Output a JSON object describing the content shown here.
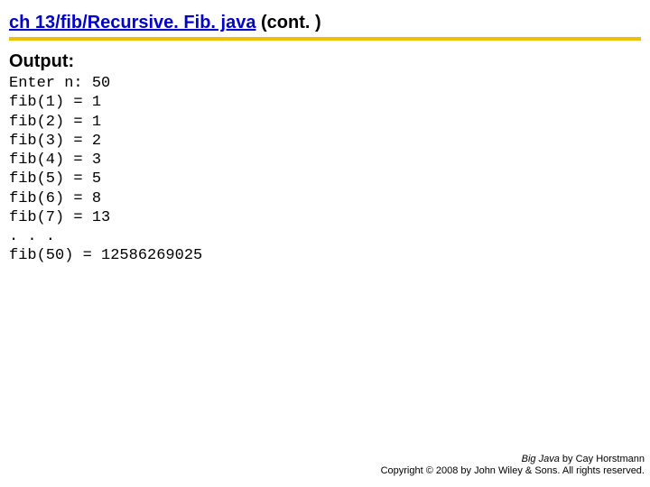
{
  "title": {
    "link_text": "ch 13/fib/Recursive. Fib. java",
    "suffix": "  (cont. )"
  },
  "subheading": "Output:",
  "code_lines": [
    "Enter n: 50",
    "fib(1) = 1",
    "fib(2) = 1",
    "fib(3) = 2",
    "fib(4) = 3",
    "fib(5) = 5",
    "fib(6) = 8",
    "fib(7) = 13",
    ". . .",
    "fib(50) = 12586269025"
  ],
  "footer": {
    "book_title": "Big Java",
    "by_author": " by Cay Horstmann",
    "copyright": "Copyright © 2008 by John Wiley & Sons. All rights reserved."
  }
}
